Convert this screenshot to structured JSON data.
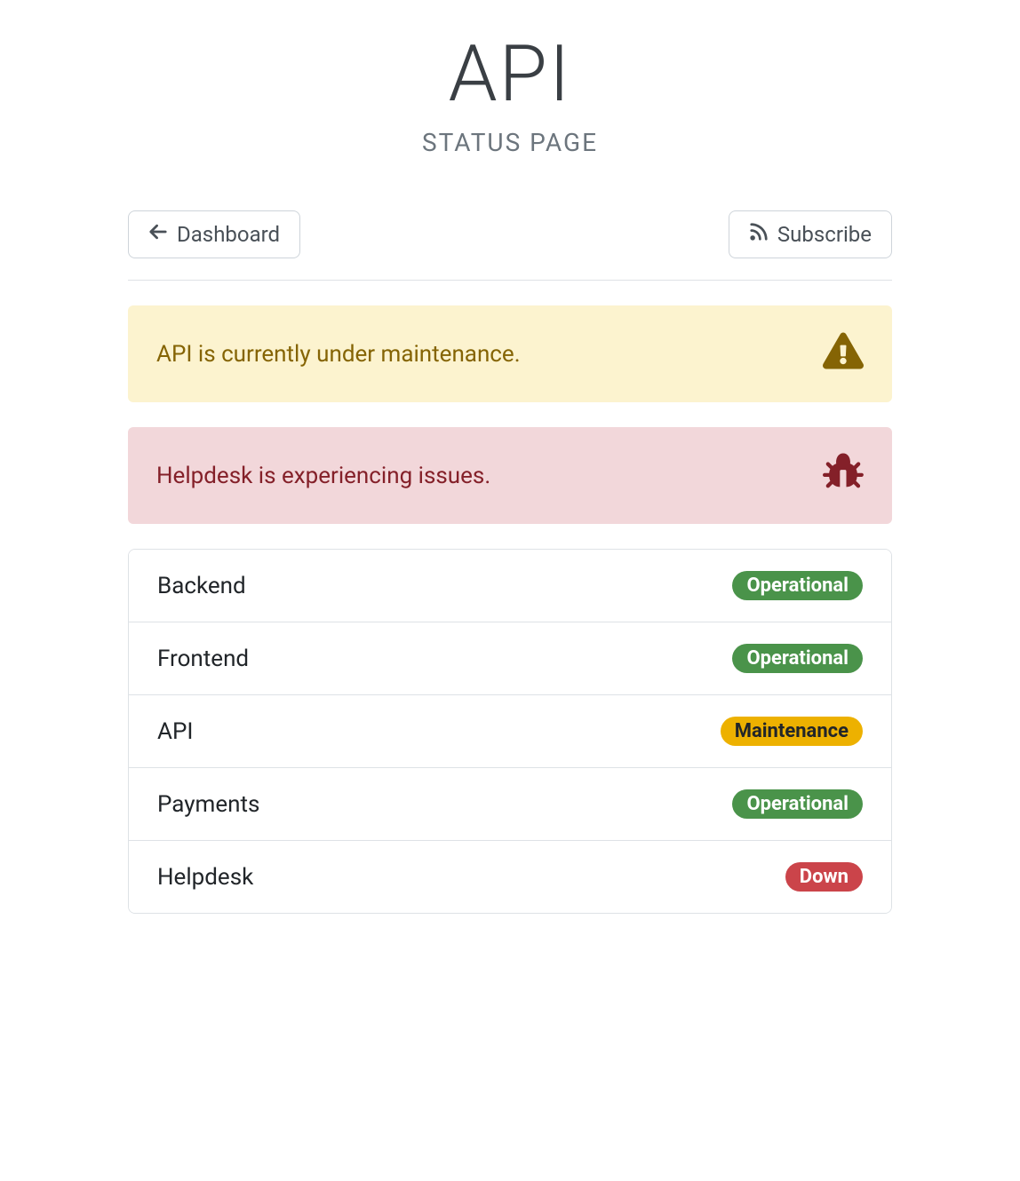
{
  "header": {
    "title": "API",
    "subtitle": "STATUS PAGE"
  },
  "actions": {
    "dashboard_label": "Dashboard",
    "subscribe_label": "Subscribe"
  },
  "alerts": [
    {
      "message": "API is currently under maintenance.",
      "type": "warning",
      "icon": "warning"
    },
    {
      "message": "Helpdesk is experiencing issues.",
      "type": "danger",
      "icon": "bug"
    }
  ],
  "components": [
    {
      "name": "Backend",
      "status": "Operational",
      "status_type": "success"
    },
    {
      "name": "Frontend",
      "status": "Operational",
      "status_type": "success"
    },
    {
      "name": "API",
      "status": "Maintenance",
      "status_type": "warning"
    },
    {
      "name": "Payments",
      "status": "Operational",
      "status_type": "success"
    },
    {
      "name": "Helpdesk",
      "status": "Down",
      "status_type": "danger"
    }
  ]
}
